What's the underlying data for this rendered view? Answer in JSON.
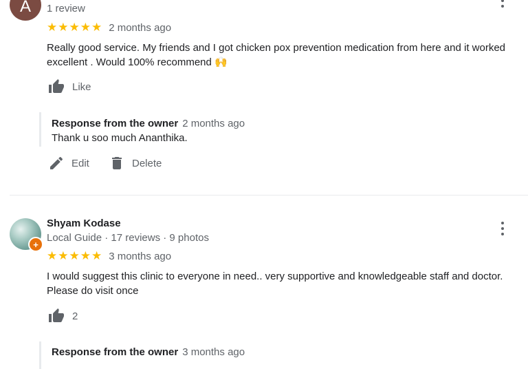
{
  "review1": {
    "avatar_letter": "A",
    "meta": "1 review",
    "stars": "★★★★★",
    "date": "2 months ago",
    "text_line1": "Really good service. My friends and I got chicken pox prevention medication from here and it worked",
    "text_line2": "excellent . Would 100% recommend 🙌",
    "like_label": "Like",
    "owner_label": "Response from the owner",
    "owner_date": "2 months ago",
    "owner_text": "Thank u soo much Ananthika.",
    "edit_label": "Edit",
    "delete_label": "Delete"
  },
  "review2": {
    "name": "Shyam Kodase",
    "meta": "Local Guide · 17 reviews · 9 photos",
    "stars": "★★★★★",
    "date": "3 months ago",
    "text_line1": "I would suggest this clinic to everyone in need.. very supportive and knowledgeable staff and doctor.",
    "text_line2": "Please do visit once",
    "like_count": "2",
    "owner_label": "Response from the owner",
    "owner_date": "3 months ago"
  },
  "colors": {
    "star": "#fbbc04",
    "muted": "#5f6368",
    "avatar_a": "#7b4b42",
    "local_guide_badge": "#e8710a"
  },
  "icons": [
    "more-vert-icon",
    "thumbs-up-icon",
    "edit-pencil-icon",
    "delete-trash-icon",
    "local-guide-badge-icon"
  ]
}
